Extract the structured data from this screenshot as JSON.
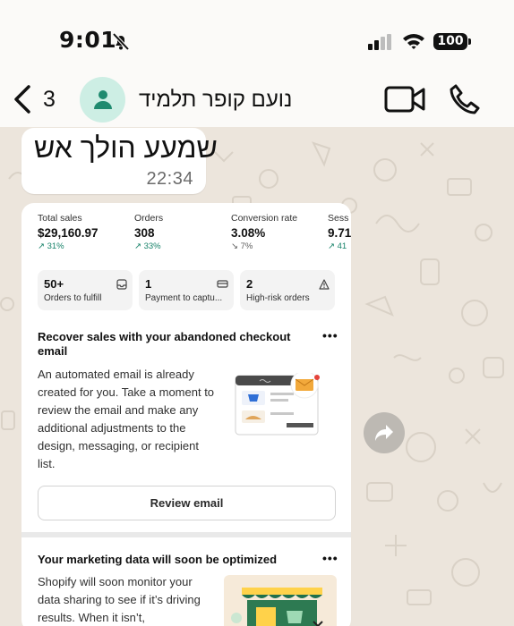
{
  "status_bar": {
    "time": "9:01",
    "battery": "100",
    "icons": [
      "bell-slash-icon",
      "signal-icon",
      "wifi-icon",
      "battery-icon"
    ]
  },
  "chat_header": {
    "back_icon": "chevron-left-icon",
    "unread_count": "3",
    "contact_name": "נועם קופר תלמיד",
    "avatar_icon": "person-icon",
    "video_icon": "video-camera-icon",
    "call_icon": "phone-icon",
    "accent_color": "#1f8a6f"
  },
  "message": {
    "text": "שמעע הולך אש",
    "time": "22:34"
  },
  "image_card": {
    "metrics": [
      {
        "label": "Total sales",
        "value": "$29,160.97",
        "change": "31%",
        "trend": "up"
      },
      {
        "label": "Orders",
        "value": "308",
        "change": "33%",
        "trend": "up"
      },
      {
        "label": "Conversion rate",
        "value": "3.08%",
        "change": "7%",
        "trend": "down"
      },
      {
        "label": "Sess",
        "value": "9.71",
        "change": "41",
        "trend": "up"
      }
    ],
    "stats": [
      {
        "value": "50+",
        "label": "Orders to fulfill",
        "icon": "inbox-icon"
      },
      {
        "value": "1",
        "label": "Payment to captu...",
        "icon": "payment-icon"
      },
      {
        "value": "2",
        "label": "High-risk orders",
        "icon": "warning-icon"
      }
    ],
    "abandoned_checkout": {
      "title": "Recover sales with your abandoned checkout email",
      "body": "An automated email is already created for you. Take a moment to review the email and make any additional adjustments to the design, messaging, or recipient list.",
      "button": "Review email",
      "menu": "•••"
    },
    "marketing": {
      "title": "Your marketing data will soon be optimized",
      "body": "Shopify will soon monitor your data sharing to see if it’s driving results. When it isn’t,",
      "menu": "•••"
    },
    "trend_up_color": "#18836a"
  },
  "forward_icon": "forward-arrow-icon"
}
